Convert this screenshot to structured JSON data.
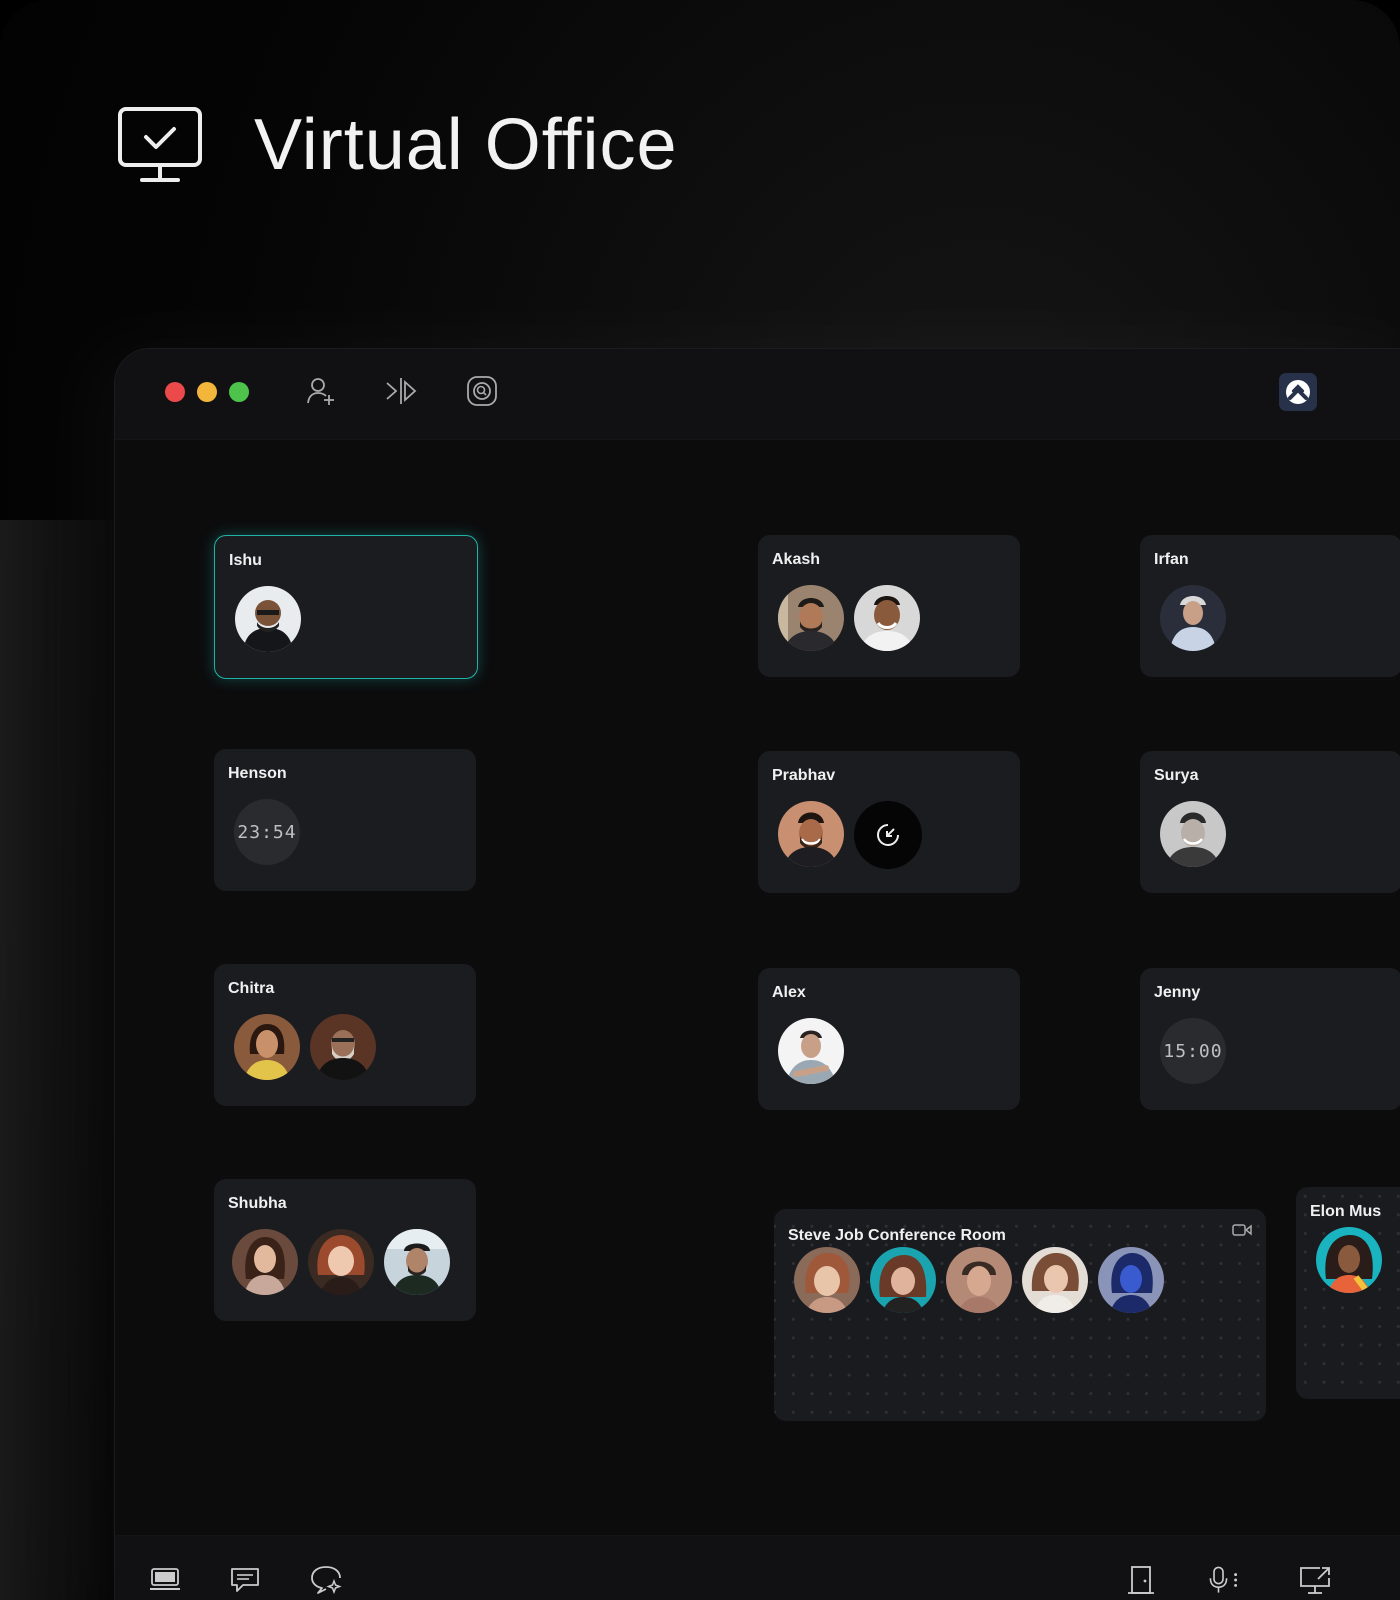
{
  "hero": {
    "title": "Virtual Office",
    "icon": "monitor-check-icon"
  },
  "titlebar": {
    "traffic_lights": {
      "close": "#ec4a4a",
      "minimize": "#f1b63a",
      "maximize": "#4ec34c"
    },
    "icons": [
      "add-user-icon",
      "mirror-icon",
      "focus-icon"
    ],
    "app_logo": "app-logo-icon"
  },
  "rooms": {
    "ishu": {
      "name": "Ishu"
    },
    "akash": {
      "name": "Akash"
    },
    "irfan": {
      "name": "Irfan"
    },
    "henson": {
      "name": "Henson",
      "clock": "23:54"
    },
    "prabhav": {
      "name": "Prabhav"
    },
    "surya": {
      "name": "Surya"
    },
    "chitra": {
      "name": "Chitra"
    },
    "alex": {
      "name": "Alex"
    },
    "jenny": {
      "name": "Jenny",
      "clock": "15:00"
    },
    "shubha": {
      "name": "Shubha"
    },
    "conference": {
      "name": "Steve Job Conference Room"
    },
    "elon": {
      "name": "Elon Mus"
    }
  },
  "accent_color": "#1fb3a7",
  "bottombar": {
    "left_icons": [
      "screen-icon",
      "chat-icon",
      "sparkle-chat-icon"
    ],
    "right_icons": [
      "door-icon",
      "microphone-icon",
      "share-screen-icon"
    ]
  }
}
